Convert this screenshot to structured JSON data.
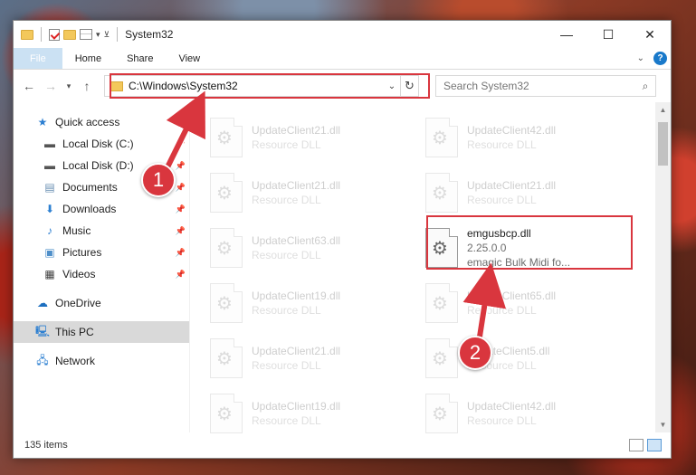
{
  "window": {
    "title": "System32",
    "controls": {
      "minimize": "—",
      "maximize": "☐",
      "close": "✕"
    }
  },
  "ribbon": {
    "tabs": [
      {
        "label": "File"
      },
      {
        "label": "Home"
      },
      {
        "label": "Share"
      },
      {
        "label": "View"
      }
    ],
    "help": "?"
  },
  "address": {
    "path": "C:\\Windows\\System32",
    "search_placeholder": "Search System32"
  },
  "nav": {
    "quick_access": "Quick access",
    "items": [
      {
        "label": "Local Disk (C:)"
      },
      {
        "label": "Local Disk (D:)"
      },
      {
        "label": "Documents"
      },
      {
        "label": "Downloads"
      },
      {
        "label": "Music"
      },
      {
        "label": "Pictures"
      },
      {
        "label": "Videos"
      }
    ],
    "onedrive": "OneDrive",
    "this_pc": "This PC",
    "network": "Network"
  },
  "files": [
    {
      "name": "UpdateClient21.dll",
      "sub": "Resource DLL"
    },
    {
      "name": "UpdateClient42.dll",
      "sub": "Resource DLL"
    },
    {
      "name": "UpdateClient21.dll",
      "sub": "Resource DLL"
    },
    {
      "name": "UpdateClient21.dll",
      "sub": "Resource DLL"
    },
    {
      "name": "UpdateClient63.dll",
      "sub": "Resource DLL"
    },
    {
      "name": "emgusbcp.dll",
      "version": "2.25.0.0",
      "sub": "emagic Bulk Midi fo..."
    },
    {
      "name": "UpdateClient19.dll",
      "sub": "Resource DLL"
    },
    {
      "name": "UpdateClient65.dll",
      "sub": "Resource DLL"
    },
    {
      "name": "UpdateClient21.dll",
      "sub": "Resource DLL"
    },
    {
      "name": "UpdateClient5.dll",
      "sub": "Resource DLL"
    },
    {
      "name": "UpdateClient19.dll",
      "sub": "Resource DLL"
    },
    {
      "name": "UpdateClient42.dll",
      "sub": "Resource DLL"
    }
  ],
  "status": {
    "count": "135 items"
  },
  "annotations": {
    "step1": "1",
    "step2": "2"
  },
  "colors": {
    "accent": "#1979ca",
    "highlight": "#d9363e"
  }
}
